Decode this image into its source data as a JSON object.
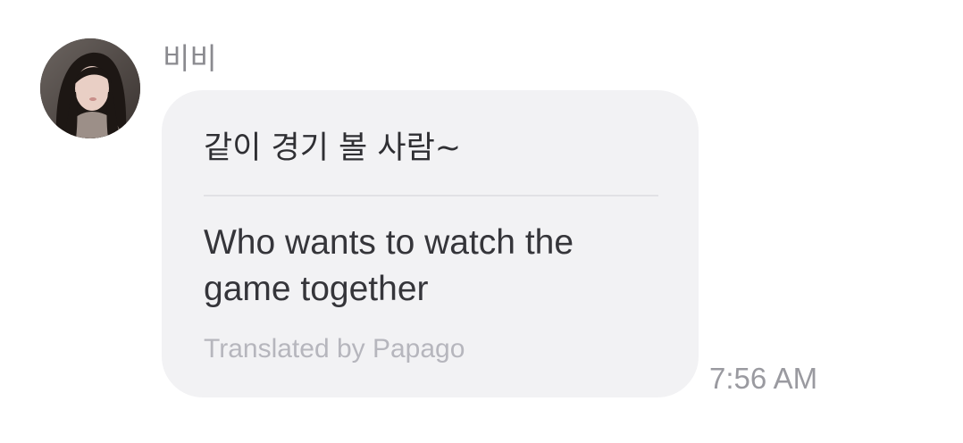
{
  "message": {
    "sender_name": "비비",
    "original_text": "같이 경기 볼 사람~",
    "translated_text": "Who wants to watch the game together",
    "translation_credit": "Translated by Papago",
    "timestamp": "7:56 AM"
  },
  "colors": {
    "bubble_background": "#f2f2f4",
    "primary_text": "#2f2f33",
    "secondary_text": "#8a8a8f",
    "credit_text": "#b6b6bd"
  }
}
